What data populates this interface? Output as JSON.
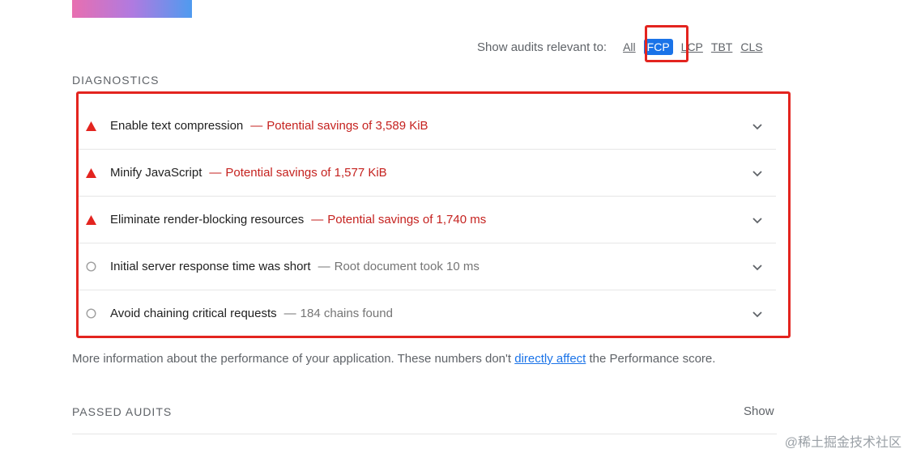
{
  "filter": {
    "label": "Show audits relevant to:",
    "options": [
      "All",
      "FCP",
      "LCP",
      "TBT",
      "CLS"
    ],
    "active": "FCP"
  },
  "diagnostics": {
    "title": "DIAGNOSTICS",
    "audits": [
      {
        "status": "fail",
        "title": "Enable text compression",
        "dash": "—",
        "detail": "Potential savings of 3,589 KiB"
      },
      {
        "status": "fail",
        "title": "Minify JavaScript",
        "dash": "—",
        "detail": "Potential savings of 1,577 KiB"
      },
      {
        "status": "fail",
        "title": "Eliminate render-blocking resources",
        "dash": "—",
        "detail": "Potential savings of 1,740 ms"
      },
      {
        "status": "info",
        "title": "Initial server response time was short",
        "dash": "—",
        "detail": "Root document took 10 ms"
      },
      {
        "status": "info",
        "title": "Avoid chaining critical requests",
        "dash": "—",
        "detail": "184 chains found"
      }
    ]
  },
  "more_info": {
    "before": "More information about the performance of your application. These numbers don't ",
    "link": "directly affect",
    "after": " the Performance score."
  },
  "passed": {
    "title": "PASSED AUDITS",
    "show_label": "Show"
  },
  "watermark": "@稀土掘金技术社区",
  "colors": {
    "fail": "#c5221f",
    "fail_icon": "#e3241f",
    "info": "#757575",
    "accent": "#1a73e8",
    "highlight": "#e3241f"
  }
}
